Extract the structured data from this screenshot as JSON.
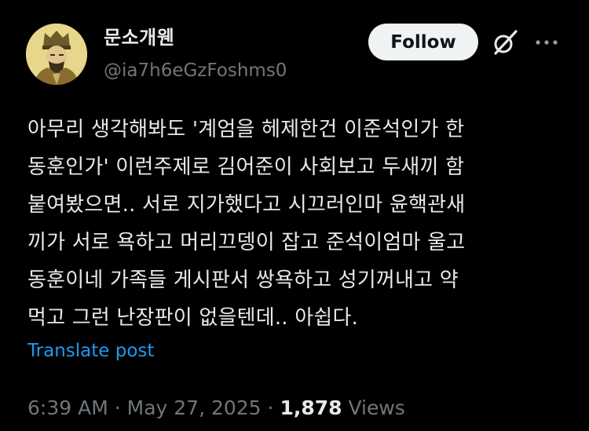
{
  "author": {
    "display_name": "문소개웬",
    "handle": "@ia7h6eGzFoshms0",
    "avatar_icon": "portrait-avatar-icon"
  },
  "header_actions": {
    "follow_label": "Follow",
    "grok_icon": "grok-icon",
    "more_icon": "more-dots-icon"
  },
  "post": {
    "text": "아무리 생각해봐도 '계엄을 헤제한건 이준석인가 한\n동훈인가' 이런주제로 김어준이 사회보고 두새끼 함\n붙여봤으면.. 서로 지가했다고 시끄러인마 윤핵관새\n끼가 서로 욕하고 머리끄뎅이 잡고 준석이엄마 울고\n동훈이네 가족들 게시판서 쌍욕하고 성기꺼내고 약\n먹고 그런 난장판이 없을텐데.. 아쉽다.",
    "translate_label": "Translate post"
  },
  "meta": {
    "time": "6:39 AM",
    "separator": "·",
    "date": "May 27, 2025",
    "views_count": "1,878",
    "views_label": "Views"
  },
  "colors": {
    "background": "#000000",
    "text_primary": "#e7e9ea",
    "text_secondary": "#71767b",
    "link": "#1d9bf0",
    "follow_bg": "#eff3f4",
    "follow_text": "#0f1419"
  }
}
